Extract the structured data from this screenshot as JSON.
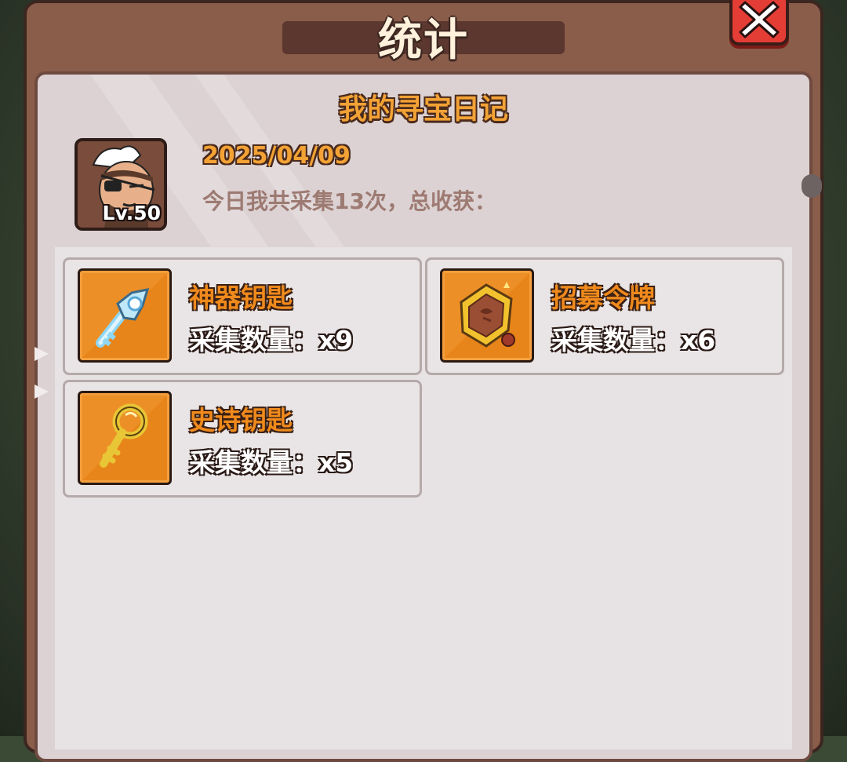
{
  "window": {
    "title": "统计"
  },
  "diary": {
    "title": "我的寻宝日记",
    "date": "2025/04/09",
    "summary": "今日我共采集13次，总收获：",
    "avatar_level": "Lv.50"
  },
  "items": [
    {
      "name": "神器钥匙",
      "count": "采集数量：x9",
      "icon": "artifact-key-icon"
    },
    {
      "name": "招募令牌",
      "count": "采集数量：x6",
      "icon": "recruit-token-icon"
    },
    {
      "name": "史诗钥匙",
      "count": "采集数量：x5",
      "icon": "epic-key-icon"
    }
  ],
  "colors": {
    "panel_brown": "#8a5d4a",
    "title_bar": "#5b372f",
    "close_red": "#e33d35",
    "accent_orange": "#f3a235",
    "icon_bg": "#e8851a"
  }
}
